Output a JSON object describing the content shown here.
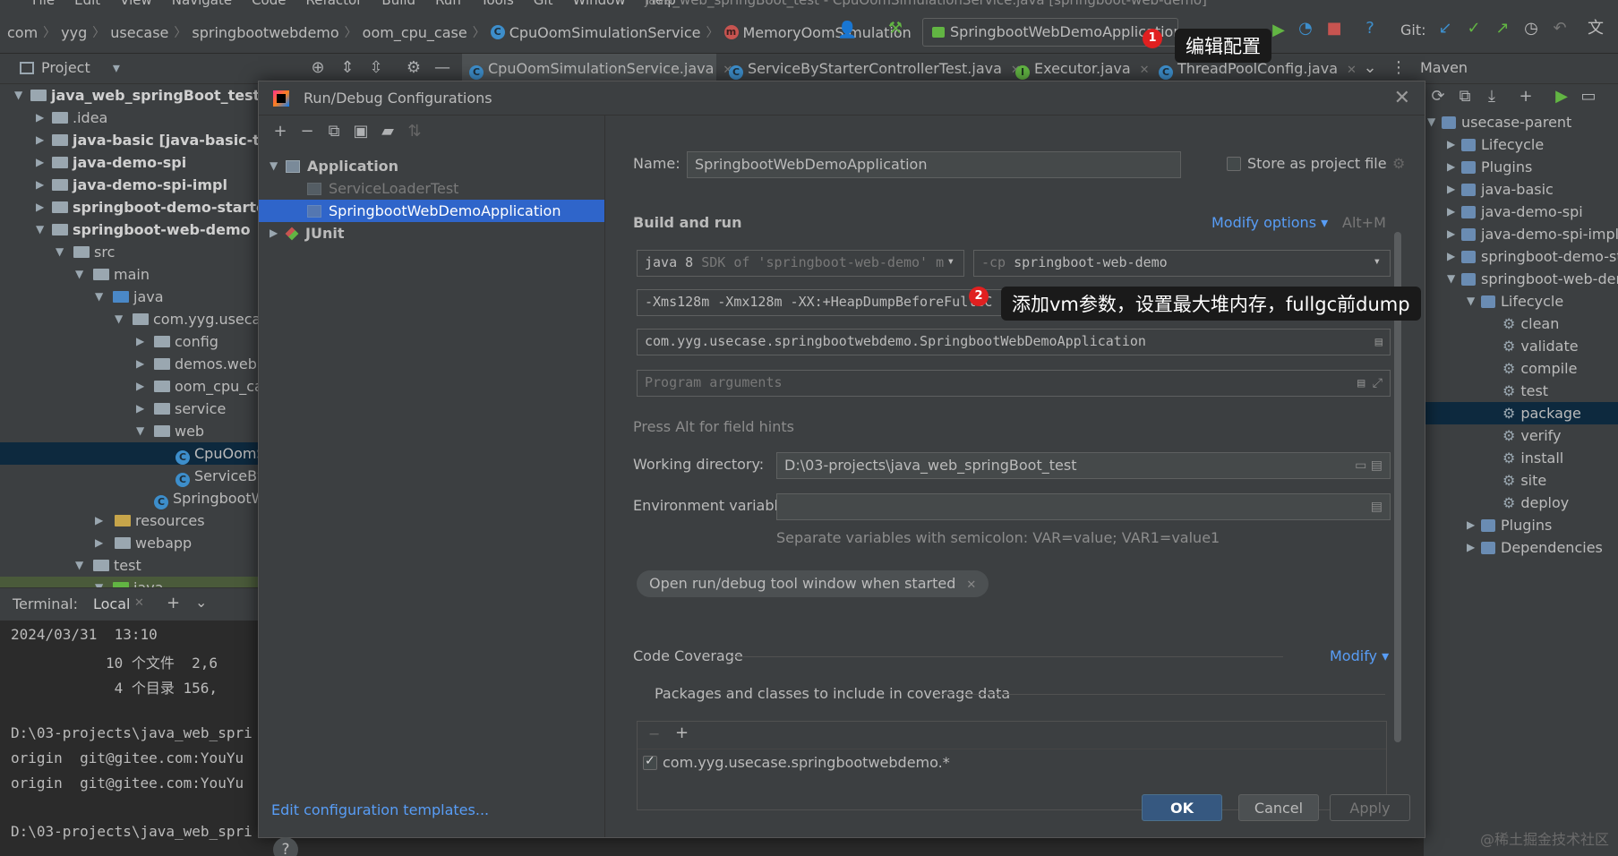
{
  "menu": {
    "items": [
      "File",
      "Edit",
      "View",
      "Navigate",
      "Code",
      "Refactor",
      "Build",
      "Run",
      "Tools",
      "Git",
      "Window",
      "Help"
    ],
    "window_title": "java_web_springBoot_test - CpuOomSimulationService.java [springboot-web-demo]"
  },
  "breadcrumb": [
    "com",
    "yyg",
    "usecase",
    "springbootwebdemo",
    "oom_cpu_case",
    "CpuOomSimulationService",
    "MemoryOomSimulation"
  ],
  "toolbar": {
    "run_config": "SpringbootWebDemoApplication",
    "git_label": "Git:",
    "maven_label": "Maven"
  },
  "annotations": {
    "badge1": "1",
    "badge1_text": "编辑配置",
    "badge2": "2",
    "badge2_text": "添加vm参数，设置最大堆内存，fullgc前dump"
  },
  "tabs": {
    "project": "Project",
    "editor": [
      "CpuOomSimulationService.java",
      "ServiceByStarterControllerTest.java",
      "Executor.java",
      "ThreadPoolConfig.java"
    ]
  },
  "project_tree": {
    "root": "java_web_springBoot_test [use",
    "items": [
      ".idea",
      "java-basic [java-basic-test]",
      "java-demo-spi",
      "java-demo-spi-impl",
      "springboot-demo-starter",
      "springboot-web-demo",
      "src",
      "main",
      "java",
      "com.yyg.usecas",
      "config",
      "demos.web",
      "oom_cpu_ca",
      "service",
      "web",
      "CpuOomS",
      "ServiceBy",
      "SpringbootW",
      "resources",
      "webapp",
      "test",
      "java"
    ]
  },
  "terminal": {
    "label": "Terminal:",
    "tab": "Local",
    "lines": [
      "2024/03/31  13:10",
      "           10 个文件  2,6",
      "            4 个目录 156,",
      "",
      "D:\\03-projects\\java_web_spri",
      "origin  git@gitee.com:YouYu",
      "origin  git@gitee.com:YouYu",
      "",
      "D:\\03-projects\\java_web_spri"
    ]
  },
  "maven_tree": {
    "items": [
      "usecase-parent",
      "Lifecycle",
      "Plugins",
      "java-basic",
      "java-demo-spi",
      "java-demo-spi-impl",
      "springboot-demo-sta",
      "springboot-web-dem",
      "Lifecycle",
      "clean",
      "validate",
      "compile",
      "test",
      "package",
      "verify",
      "install",
      "site",
      "deploy",
      "Plugins",
      "Dependencies"
    ]
  },
  "dialog": {
    "title": "Run/Debug Configurations",
    "tree": {
      "application": "Application",
      "service_loader": "ServiceLoaderTest",
      "selected": "SpringbootWebDemoApplication",
      "junit": "JUnit"
    },
    "edit_templates": "Edit configuration templates...",
    "name_label": "Name:",
    "name_value": "SpringbootWebDemoApplication",
    "store_label": "Store as project file",
    "build_run": "Build and run",
    "modify_options": "Modify options",
    "modify_shortcut": "Alt+M",
    "jdk_value": "java 8",
    "jdk_hint": "SDK of 'springboot-web-demo' m",
    "cp_prefix": "-cp",
    "cp_value": "springboot-web-demo",
    "vm_options": "-Xms128m -Xmx128m -XX:+HeapDumpBeforeFullGC -XX:HeapDumpPath=D:\\03-projects\\java_web_spr",
    "main_class": "com.yyg.usecase.springbootwebdemo.SpringbootWebDemoApplication",
    "program_args_placeholder": "Program arguments",
    "press_alt": "Press Alt for field hints",
    "workdir_label": "Working directory:",
    "workdir_value": "D:\\03-projects\\java_web_springBoot_test",
    "env_label": "Environment variables:",
    "env_hint": "Separate variables with semicolon: VAR=value; VAR1=value1",
    "chip_label": "Open run/debug tool window when started",
    "coverage_label": "Code Coverage",
    "coverage_modify": "Modify",
    "coverage_desc": "Packages and classes to include in coverage data",
    "coverage_item": "com.yyg.usecase.springbootwebdemo.*",
    "ok": "OK",
    "cancel": "Cancel",
    "apply": "Apply"
  },
  "watermark": "@稀土掘金技术社区",
  "colors": {
    "accent": "#2f65ca",
    "link": "#589df6",
    "badge": "#e02020"
  }
}
